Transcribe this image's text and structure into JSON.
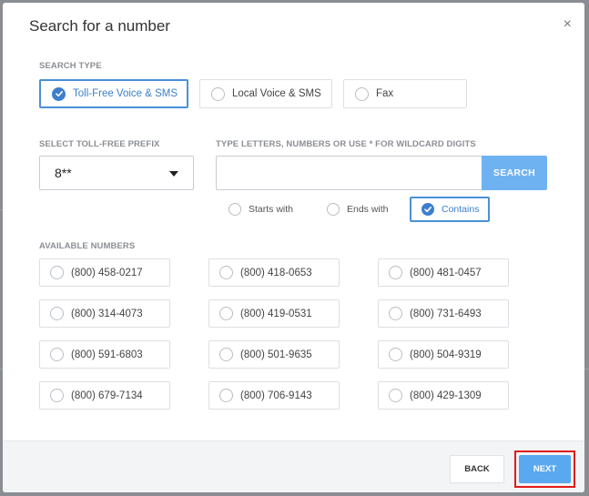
{
  "dialog": {
    "title": "Search for a number",
    "close_glyph": "×"
  },
  "search_type": {
    "label": "SEARCH TYPE",
    "options": [
      {
        "label": "Toll-Free Voice & SMS",
        "selected": true
      },
      {
        "label": "Local Voice & SMS",
        "selected": false
      },
      {
        "label": "Fax",
        "selected": false
      }
    ]
  },
  "prefix": {
    "label": "SELECT TOLL-FREE PREFIX",
    "value": "8**"
  },
  "search": {
    "label": "TYPE LETTERS, NUMBERS OR USE * FOR WILDCARD DIGITS",
    "value": "",
    "placeholder": "",
    "button_label": "SEARCH"
  },
  "match_mode": {
    "options": [
      {
        "label": "Starts with",
        "selected": false
      },
      {
        "label": "Ends with",
        "selected": false
      },
      {
        "label": "Contains",
        "selected": true
      }
    ]
  },
  "available": {
    "label": "AVAILABLE NUMBERS",
    "numbers": [
      "(800) 458-0217",
      "(800) 418-0653",
      "(800) 481-0457",
      "(800) 314-4073",
      "(800) 419-0531",
      "(800) 731-6493",
      "(800) 591-6803",
      "(800) 501-9635",
      "(800) 504-9319",
      "(800) 679-7134",
      "(800) 706-9143",
      "(800) 429-1309"
    ]
  },
  "footer": {
    "back_label": "BACK",
    "next_label": "NEXT"
  },
  "colors": {
    "accent": "#3d7fcc",
    "primary_button": "#5aa8f0",
    "highlight_outline": "#e01b1b"
  }
}
